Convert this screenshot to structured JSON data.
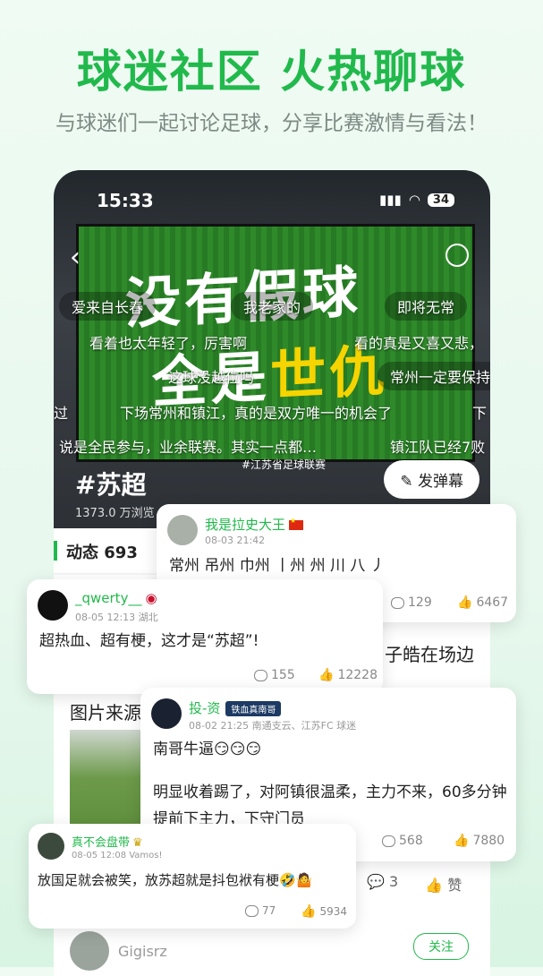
{
  "promo": {
    "headline": "球迷社区 火热聊球",
    "subline": "与球迷们一起讨论足球，分享比赛激情与看法！"
  },
  "status_bar": {
    "time": "15:33",
    "battery": "34"
  },
  "hero": {
    "screen_line1": "没有假球",
    "screen_line2a": "全是",
    "screen_line2b": "世仇",
    "screen_footer": "#江苏省足球联赛",
    "tag": "#苏超",
    "views": "1373.0 万浏览",
    "send_danmu_label": "发弹幕",
    "danmu": [
      "爱来自长春",
      "我老家的",
      "即将无常",
      "看着也太年轻了，厉害啊",
      "看的真是又喜又悲，",
      "这球没越位吗",
      "常州一定要保持",
      "过",
      "下场常州和镇江，真的是双方唯一的机会了",
      "下",
      "说是全民参与，业余联赛。其实一点都…",
      "镇江队已经7败"
    ]
  },
  "dynamics": {
    "label": "动态 693"
  },
  "feed": {
    "peek_text_right": "子皓在场边",
    "peek_text_left": "图片来源",
    "actions": {
      "comments": "3",
      "like": "赞"
    },
    "next_user": "Gigisrz",
    "follow_label": "关注"
  },
  "cards": [
    {
      "username": "我是拉史大王",
      "meta": "08-03 21:42",
      "text": "常州 吊州 巾州 丨州 州 川 八 丿",
      "comments": "129",
      "likes": "6467"
    },
    {
      "username": "_qwerty__",
      "meta": "08-05 12:13 湖北",
      "text": "超热血、超有梗，这才是“苏超”!",
      "comments": "155",
      "likes": "12228"
    },
    {
      "username": "投-资",
      "badge": "铁血真南哥",
      "meta": "08-02 21:25 南通支云、江苏FC 球迷",
      "text1": "南哥牛逼😏😏😏",
      "text2": "明显收着踢了，对阿镇很温柔，主力不来，60多分钟提前下主力，下守门员",
      "comments": "568",
      "likes": "7880"
    },
    {
      "username": "真不会盘带",
      "meta": "08-05 12:08 Vamos!",
      "text": "放国足就会被笑，放苏超就是抖包袱有梗🤣🤷",
      "comments": "77",
      "likes": "5934"
    }
  ]
}
